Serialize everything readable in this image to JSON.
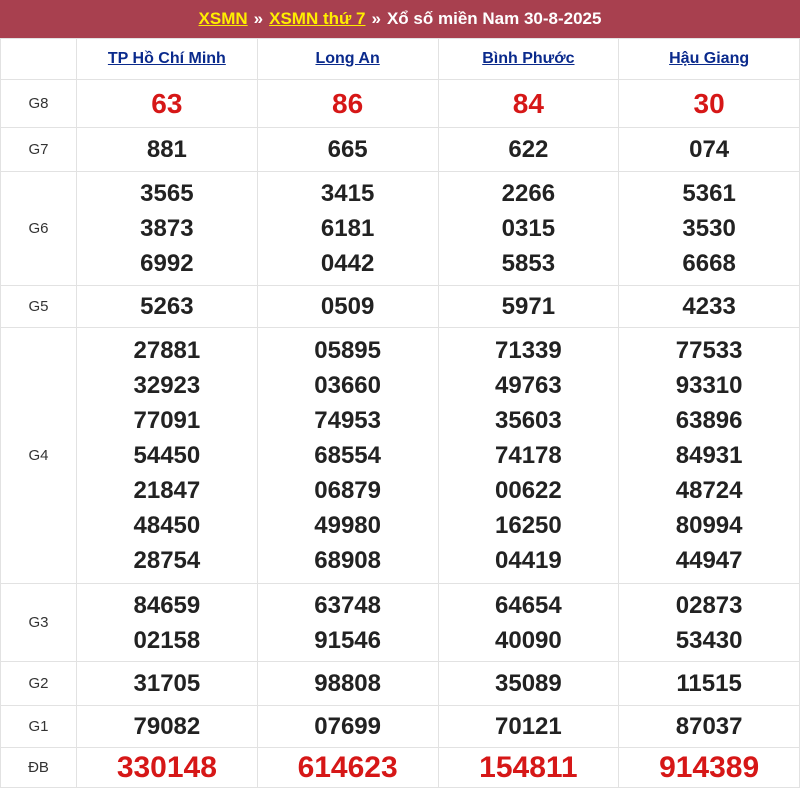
{
  "header": {
    "link1": "XSMN",
    "sep": "»",
    "link2": "XSMN thứ 7",
    "title": "Xổ số miền Nam 30-8-2025"
  },
  "provinces": [
    "TP Hồ Chí Minh",
    "Long An",
    "Bình Phước",
    "Hậu Giang"
  ],
  "rows": [
    {
      "label": "G8",
      "style": "red",
      "cells": [
        [
          "63"
        ],
        [
          "86"
        ],
        [
          "84"
        ],
        [
          "30"
        ]
      ]
    },
    {
      "label": "G7",
      "style": "",
      "cells": [
        [
          "881"
        ],
        [
          "665"
        ],
        [
          "622"
        ],
        [
          "074"
        ]
      ]
    },
    {
      "label": "G6",
      "style": "",
      "cells": [
        [
          "3565",
          "3873",
          "6992"
        ],
        [
          "3415",
          "6181",
          "0442"
        ],
        [
          "2266",
          "0315",
          "5853"
        ],
        [
          "5361",
          "3530",
          "6668"
        ]
      ]
    },
    {
      "label": "G5",
      "style": "",
      "cells": [
        [
          "5263"
        ],
        [
          "0509"
        ],
        [
          "5971"
        ],
        [
          "4233"
        ]
      ]
    },
    {
      "label": "G4",
      "style": "",
      "cells": [
        [
          "27881",
          "32923",
          "77091",
          "54450",
          "21847",
          "48450",
          "28754"
        ],
        [
          "05895",
          "03660",
          "74953",
          "68554",
          "06879",
          "49980",
          "68908"
        ],
        [
          "71339",
          "49763",
          "35603",
          "74178",
          "00622",
          "16250",
          "04419"
        ],
        [
          "77533",
          "93310",
          "63896",
          "84931",
          "48724",
          "80994",
          "44947"
        ]
      ]
    },
    {
      "label": "G3",
      "style": "",
      "cells": [
        [
          "84659",
          "02158"
        ],
        [
          "63748",
          "91546"
        ],
        [
          "64654",
          "40090"
        ],
        [
          "02873",
          "53430"
        ]
      ]
    },
    {
      "label": "G2",
      "style": "",
      "cells": [
        [
          "31705"
        ],
        [
          "98808"
        ],
        [
          "35089"
        ],
        [
          "11515"
        ]
      ]
    },
    {
      "label": "G1",
      "style": "",
      "cells": [
        [
          "79082"
        ],
        [
          "07699"
        ],
        [
          "70121"
        ],
        [
          "87037"
        ]
      ]
    },
    {
      "label": "ĐB",
      "style": "big",
      "cells": [
        [
          "330148"
        ],
        [
          "614623"
        ],
        [
          "154811"
        ],
        [
          "914389"
        ]
      ]
    }
  ]
}
